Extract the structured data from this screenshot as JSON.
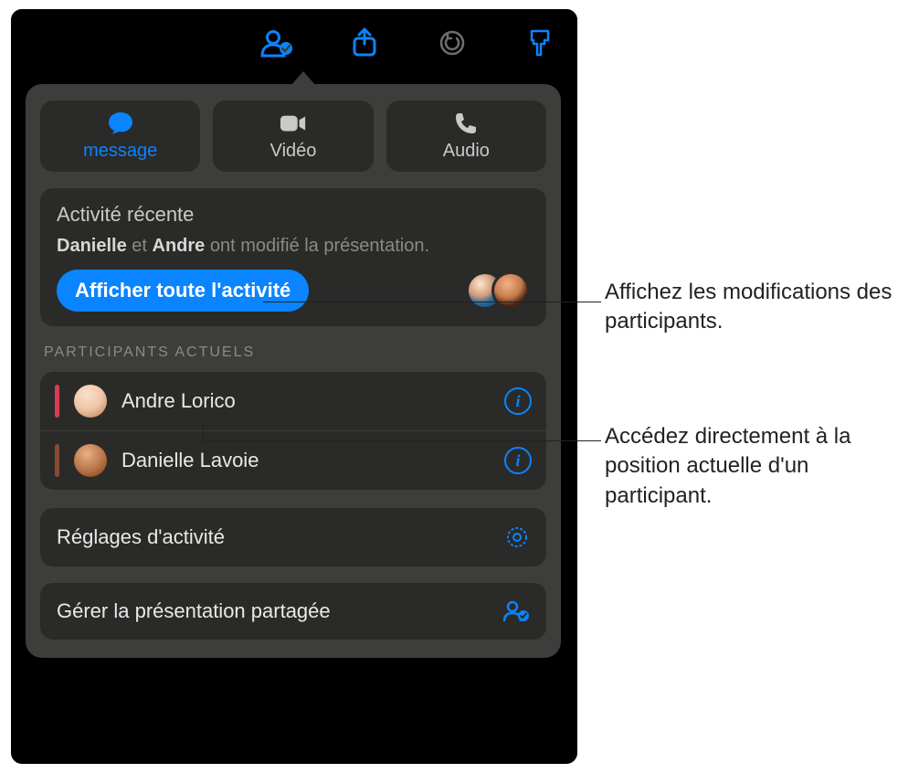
{
  "comm": {
    "message": "message",
    "video": "Vidéo",
    "audio": "Audio"
  },
  "activity": {
    "title": "Activité récente",
    "name1": "Danielle",
    "joiner": " et ",
    "name2": "Andre",
    "rest": " ont modifié la présentation.",
    "showAll": "Afficher toute l'activité"
  },
  "participants": {
    "label": "PARTICIPANTS ACTUELS",
    "items": [
      {
        "name": "Andre Lorico"
      },
      {
        "name": "Danielle Lavoie"
      }
    ]
  },
  "settings": {
    "activitySettings": "Réglages d'activité",
    "manageShared": "Gérer la présentation partagée"
  },
  "callouts": {
    "c1": "Affichez les modifications des participants.",
    "c2": "Accédez directement à la position actuelle d'un participant."
  }
}
